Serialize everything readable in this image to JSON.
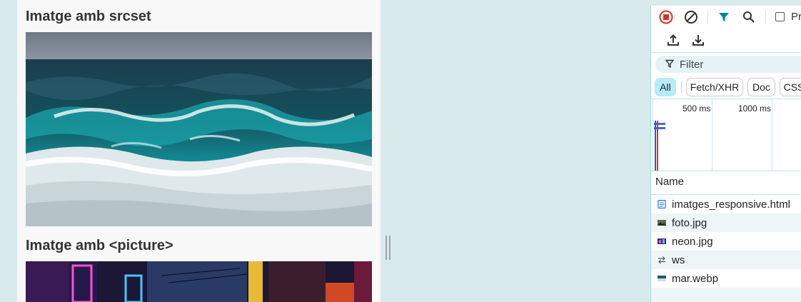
{
  "page": {
    "headings": [
      "Imatge amb srcset",
      "Imatge amb <picture>"
    ]
  },
  "devtools": {
    "toolbar": {
      "icons": [
        "record-stop-icon",
        "clear-icon",
        "filter-icon",
        "search-icon"
      ],
      "preserve_log_label": "Pr",
      "row2_icons": [
        "import-icon",
        "export-icon"
      ]
    },
    "filter": {
      "placeholder": "Filter",
      "value": ""
    },
    "type_filters": [
      "All",
      "Fetch/XHR",
      "Doc",
      "CSS"
    ],
    "active_type_filter": "All",
    "timeline": {
      "ticks": [
        "500 ms",
        "1000 ms"
      ]
    },
    "table": {
      "column_header": "Name",
      "rows": [
        {
          "name": "imatges_responsive.html",
          "icon": "document-icon"
        },
        {
          "name": "foto.jpg",
          "icon": "image-icon"
        },
        {
          "name": "neon.jpg",
          "icon": "image-icon"
        },
        {
          "name": "ws",
          "icon": "websocket-icon"
        },
        {
          "name": "mar.webp",
          "icon": "image-icon"
        }
      ]
    }
  },
  "colors": {
    "background": "#d9eaed",
    "accent": "#00809d",
    "record_red": "#d93025",
    "active_chip": "#b6ecf7",
    "row_alt": "#eef5f6"
  }
}
